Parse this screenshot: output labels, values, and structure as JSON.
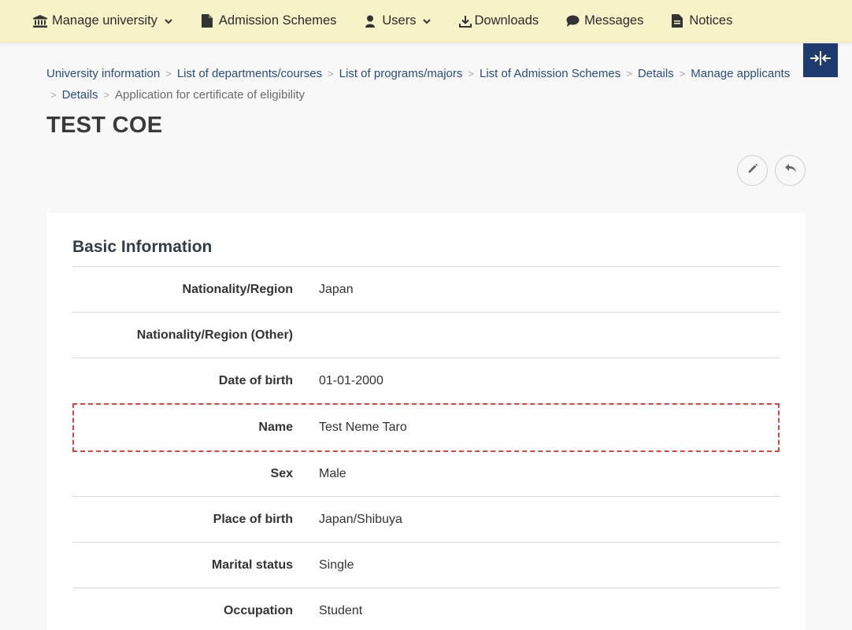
{
  "nav": {
    "items": [
      {
        "label": "Manage university",
        "icon": "bank-icon",
        "dropdown": true
      },
      {
        "label": "Admission Schemes",
        "icon": "file-icon",
        "dropdown": false
      },
      {
        "label": "Users",
        "icon": "user-icon",
        "dropdown": true
      },
      {
        "label": "Downloads",
        "icon": "download-icon",
        "dropdown": false
      },
      {
        "label": "Messages",
        "icon": "chat-icon",
        "dropdown": false
      },
      {
        "label": "Notices",
        "icon": "document-icon",
        "dropdown": false
      }
    ]
  },
  "breadcrumb": {
    "links": [
      "University information",
      "List of departments/courses",
      "List of programs/majors",
      "List of Admission Schemes",
      "Details",
      "Manage applicants",
      "Details"
    ],
    "current": "Application for certificate of eligibility",
    "separator": ">"
  },
  "page": {
    "title": "TEST COE"
  },
  "card": {
    "section_title": "Basic Information",
    "rows": [
      {
        "label": "Nationality/Region",
        "value": "Japan"
      },
      {
        "label": "Nationality/Region (Other)",
        "value": ""
      },
      {
        "label": "Date of birth",
        "value": "01-01-2000"
      },
      {
        "label": "Name",
        "value": "Test Neme Taro",
        "highlighted": true
      },
      {
        "label": "Sex",
        "value": "Male"
      },
      {
        "label": "Place of birth",
        "value": "Japan/Shibuya"
      },
      {
        "label": "Marital status",
        "value": "Single"
      },
      {
        "label": "Occupation",
        "value": "Student"
      }
    ]
  },
  "colors": {
    "nav_bg": "#f7f2c7",
    "accent": "#1d3b6e",
    "link": "#2a4d80",
    "highlight_border": "#e2433a"
  }
}
